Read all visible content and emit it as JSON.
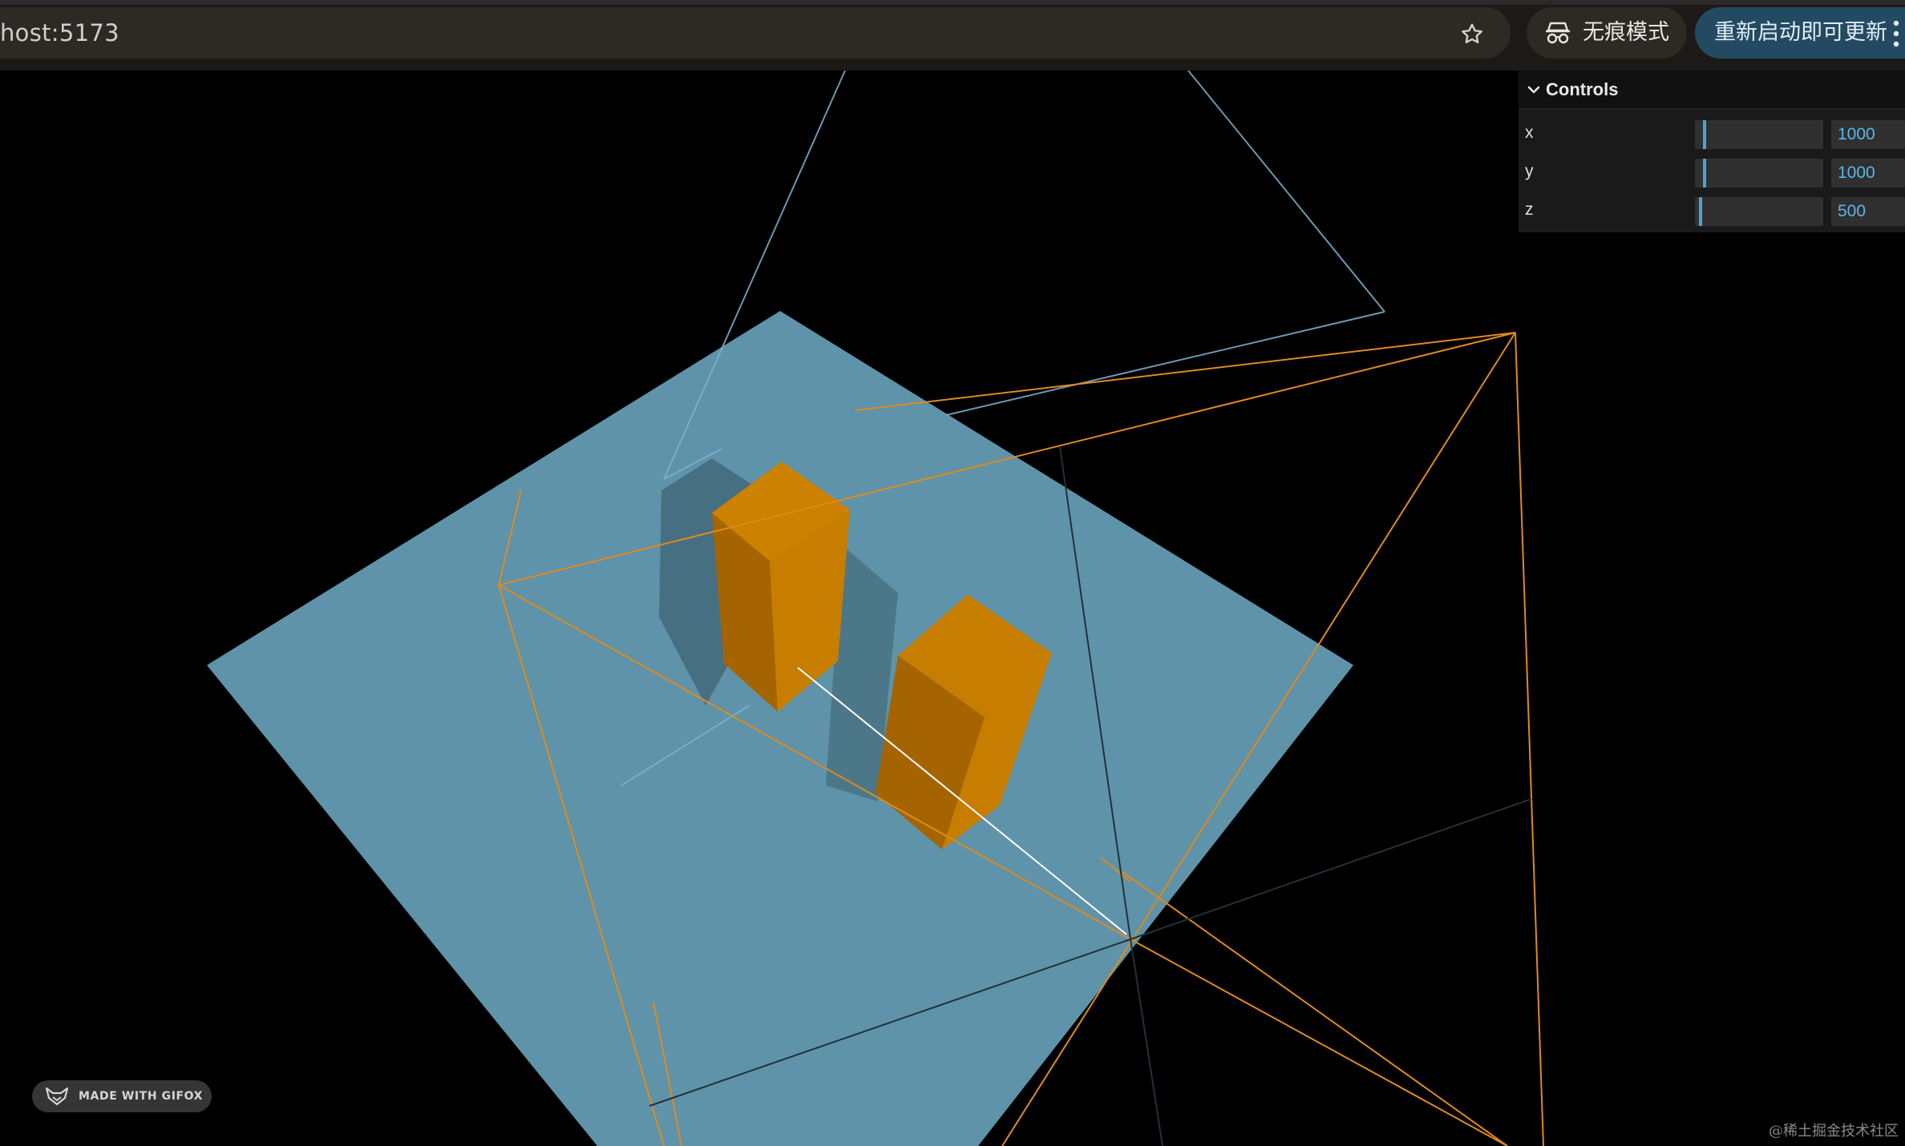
{
  "browser": {
    "url": "host:5173",
    "incognito_label": "无痕模式",
    "update_label": "重新启动即可更新"
  },
  "controls": {
    "title": "Controls",
    "rows": [
      {
        "label": "x",
        "value": "1000",
        "fraction": 0.06
      },
      {
        "label": "y",
        "value": "1000",
        "fraction": 0.06
      },
      {
        "label": "z",
        "value": "500",
        "fraction": 0.03
      }
    ]
  },
  "scene": {
    "colors": {
      "ground": "#5e93aa",
      "box": "#c47a00",
      "box_dark": "#a06200",
      "shadow": "#476f82",
      "camera_helper_orange": "#e08a1e",
      "camera_helper_blue": "#7fb2d1",
      "axis_line": "#ffffff"
    }
  },
  "watermarks": {
    "gifox": "MADE WITH GIFOX",
    "site": "@稀土掘金技术社区"
  }
}
